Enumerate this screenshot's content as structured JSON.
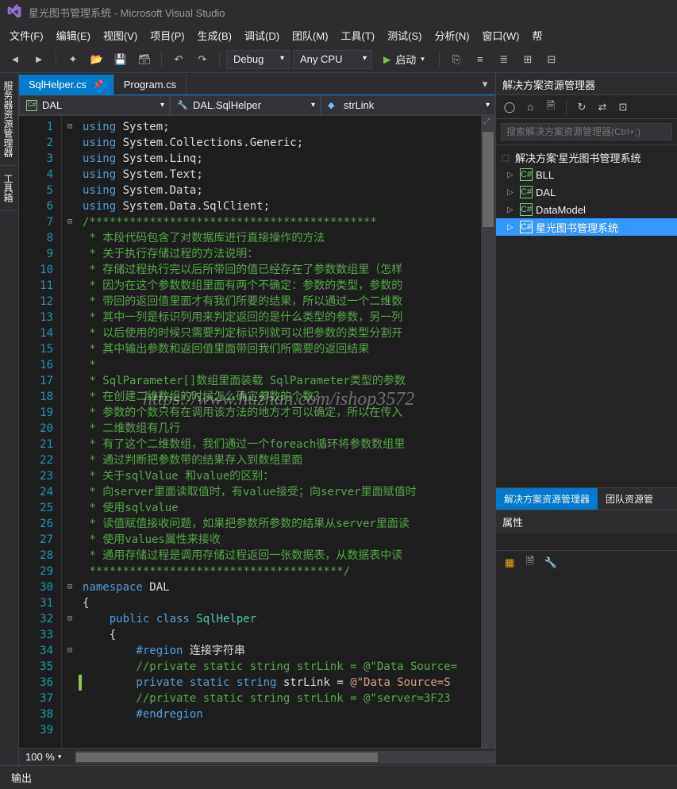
{
  "title": "星光图书管理系统 - Microsoft Visual Studio",
  "menu": [
    "文件(F)",
    "编辑(E)",
    "视图(V)",
    "项目(P)",
    "生成(B)",
    "调试(D)",
    "团队(M)",
    "工具(T)",
    "测试(S)",
    "分析(N)",
    "窗口(W)",
    "帮"
  ],
  "toolbar": {
    "config": "Debug",
    "platform": "Any CPU",
    "start": "启动"
  },
  "tabs": [
    {
      "label": "SqlHelper.cs",
      "active": true
    },
    {
      "label": "Program.cs",
      "active": false
    }
  ],
  "navbar": {
    "project": "DAL",
    "class": "DAL.SqlHelper",
    "member": "strLink"
  },
  "code": {
    "lines": [
      {
        "n": 1,
        "fold": "⊟",
        "t": "using",
        "a": " ",
        "b": "System",
        "c": ";"
      },
      {
        "n": 2,
        "t": "using",
        "a": " ",
        "b": "System.Collections.Generic",
        "c": ";"
      },
      {
        "n": 3,
        "t": "using",
        "a": " ",
        "b": "System.Linq",
        "c": ";"
      },
      {
        "n": 4,
        "t": "using",
        "a": " ",
        "b": "System.Text",
        "c": ";"
      },
      {
        "n": 5,
        "t": "using",
        "a": " ",
        "b": "System.Data",
        "c": ";"
      },
      {
        "n": 6,
        "t": "using",
        "a": " ",
        "b": "System.Data.SqlClient",
        "c": ";"
      },
      {
        "n": 7,
        "fold": "⊟",
        "cm": "/*******************************************"
      },
      {
        "n": 8,
        "cm": " * 本段代码包含了对数据库进行直接操作的方法"
      },
      {
        "n": 9,
        "cm": " * 关于执行存储过程的方法说明："
      },
      {
        "n": 10,
        "cm": " * 存储过程执行完以后所带回的值已经存在了参数数组里（怎样"
      },
      {
        "n": 11,
        "cm": " * 因为在这个参数数组里面有两个不确定：参数的类型，参数的"
      },
      {
        "n": 12,
        "cm": " * 带回的返回值里面才有我们所要的结果，所以通过一个二维数"
      },
      {
        "n": 13,
        "cm": " * 其中一列是标识列用来判定返回的是什么类型的参数，另一列"
      },
      {
        "n": 14,
        "cm": " * 以后使用的时候只需要判定标识列就可以把参数的类型分割开"
      },
      {
        "n": 15,
        "cm": " * 其中输出参数和返回值里面带回我们所需要的返回结果"
      },
      {
        "n": 16,
        "cm": " * "
      },
      {
        "n": 17,
        "cm": " * SqlParameter[]数组里面装载 SqlParameter类型的参数"
      },
      {
        "n": 18,
        "cm": " * 在创建二维数组的时候怎么确定参数的个数？"
      },
      {
        "n": 19,
        "cm": " * 参数的个数只有在调用该方法的地方才可以确定，所以在传入"
      },
      {
        "n": 20,
        "cm": " * 二维数组有几行"
      },
      {
        "n": 21,
        "cm": " * 有了这个二维数组，我们通过一个foreach循环将参数数组里"
      },
      {
        "n": 22,
        "cm": " * 通过判断把参数带的结果存入到数组里面"
      },
      {
        "n": 23,
        "cm": " * 关于sqlValue 和value的区别："
      },
      {
        "n": 24,
        "cm": " * 向server里面读取值时，有value接受；向server里面赋值时"
      },
      {
        "n": 25,
        "cm": " * 使用sqlvalue"
      },
      {
        "n": 26,
        "cm": " * 读值赋值接收问题，如果把参数所参数的结果从server里面读"
      },
      {
        "n": 27,
        "cm": " * 使用values属性来接收"
      },
      {
        "n": 28,
        "cm": " * 通用存储过程是调用存储过程返回一张数据表，从数据表中读"
      },
      {
        "n": 29,
        "cm": " **************************************/"
      },
      {
        "n": 30,
        "fold": "⊟",
        "ns": "namespace",
        "nsn": " DAL"
      },
      {
        "n": 31,
        "raw": "{"
      },
      {
        "n": 32,
        "fold": "⊟",
        "pub": "    public class ",
        "cls": "SqlHelper"
      },
      {
        "n": 33,
        "raw": "    {"
      },
      {
        "n": 34,
        "fold": "⊟",
        "reg": "        #region ",
        "regt": "连接字符串"
      },
      {
        "n": 35,
        "cm2": "        //private static string strLink = @\"Data Source="
      },
      {
        "n": 36,
        "mod": true,
        "pvt": "        private static string ",
        "fld": "strLink",
        "eq": " = ",
        "str": "@\"Data Source=S"
      },
      {
        "n": 37,
        "cm2": "        //private static string strLink = @\"server=3F23"
      },
      {
        "n": 38,
        "reg": "        #endregion"
      },
      {
        "n": 39,
        "raw": ""
      }
    ]
  },
  "zoom": "100 %",
  "solution_explorer": {
    "title": "解决方案资源管理器",
    "search_placeholder": "搜索解决方案资源管理器(Ctrl+;)",
    "root": "解决方案'星光图书管理系统",
    "nodes": [
      {
        "label": "BLL"
      },
      {
        "label": "DAL"
      },
      {
        "label": "DataModel"
      },
      {
        "label": "星光图书管理系统",
        "selected": true
      }
    ],
    "bottom_tabs": [
      "解决方案资源管理器",
      "团队资源管"
    ]
  },
  "properties": {
    "title": "属性"
  },
  "output": {
    "label": "输出"
  },
  "watermark": "https://www.huzhan.com/ishop3572"
}
